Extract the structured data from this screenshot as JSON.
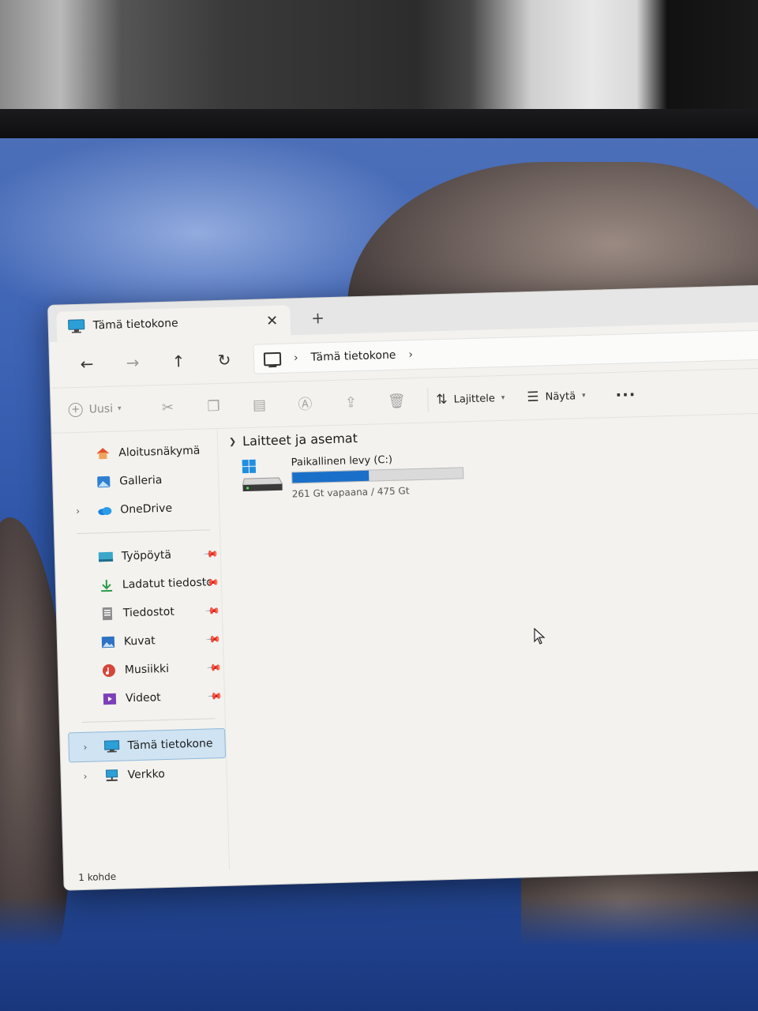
{
  "window": {
    "tab_title": "Tämä tietokone",
    "new_tab_label": "+",
    "close_label": "✕"
  },
  "nav": {
    "back": "←",
    "forward": "→",
    "up": "↑",
    "refresh": "↻"
  },
  "address": {
    "crumb": "Tämä tietokone",
    "sep": "›"
  },
  "toolbar": {
    "new_label": "Uusi",
    "sort_label": "Lajittele",
    "view_label": "Näytä",
    "more_label": "···"
  },
  "sidebar": {
    "top_items": [
      {
        "label": "Aloitusnäkymä",
        "icon": "home-icon"
      },
      {
        "label": "Galleria",
        "icon": "gallery-icon"
      },
      {
        "label": "OneDrive",
        "icon": "cloud-icon"
      }
    ],
    "pinned_items": [
      {
        "label": "Työpöytä",
        "icon": "desktop-icon"
      },
      {
        "label": "Ladatut tiedosto",
        "icon": "download-icon"
      },
      {
        "label": "Tiedostot",
        "icon": "documents-icon"
      },
      {
        "label": "Kuvat",
        "icon": "pictures-icon"
      },
      {
        "label": "Musiikki",
        "icon": "music-icon"
      },
      {
        "label": "Videot",
        "icon": "videos-icon"
      }
    ],
    "this_pc": "Tämä tietokone",
    "network": "Verkko"
  },
  "main": {
    "section_title": "Laitteet ja asemat",
    "drive": {
      "name": "Paikallinen levy (C:)",
      "free_text": "261 Gt vapaana / 475 Gt",
      "used_fraction": 0.45
    }
  },
  "status": {
    "item_count": "1 kohde"
  },
  "colors": {
    "accent": "#1a6fc9",
    "selection": "#cfe3f2"
  }
}
